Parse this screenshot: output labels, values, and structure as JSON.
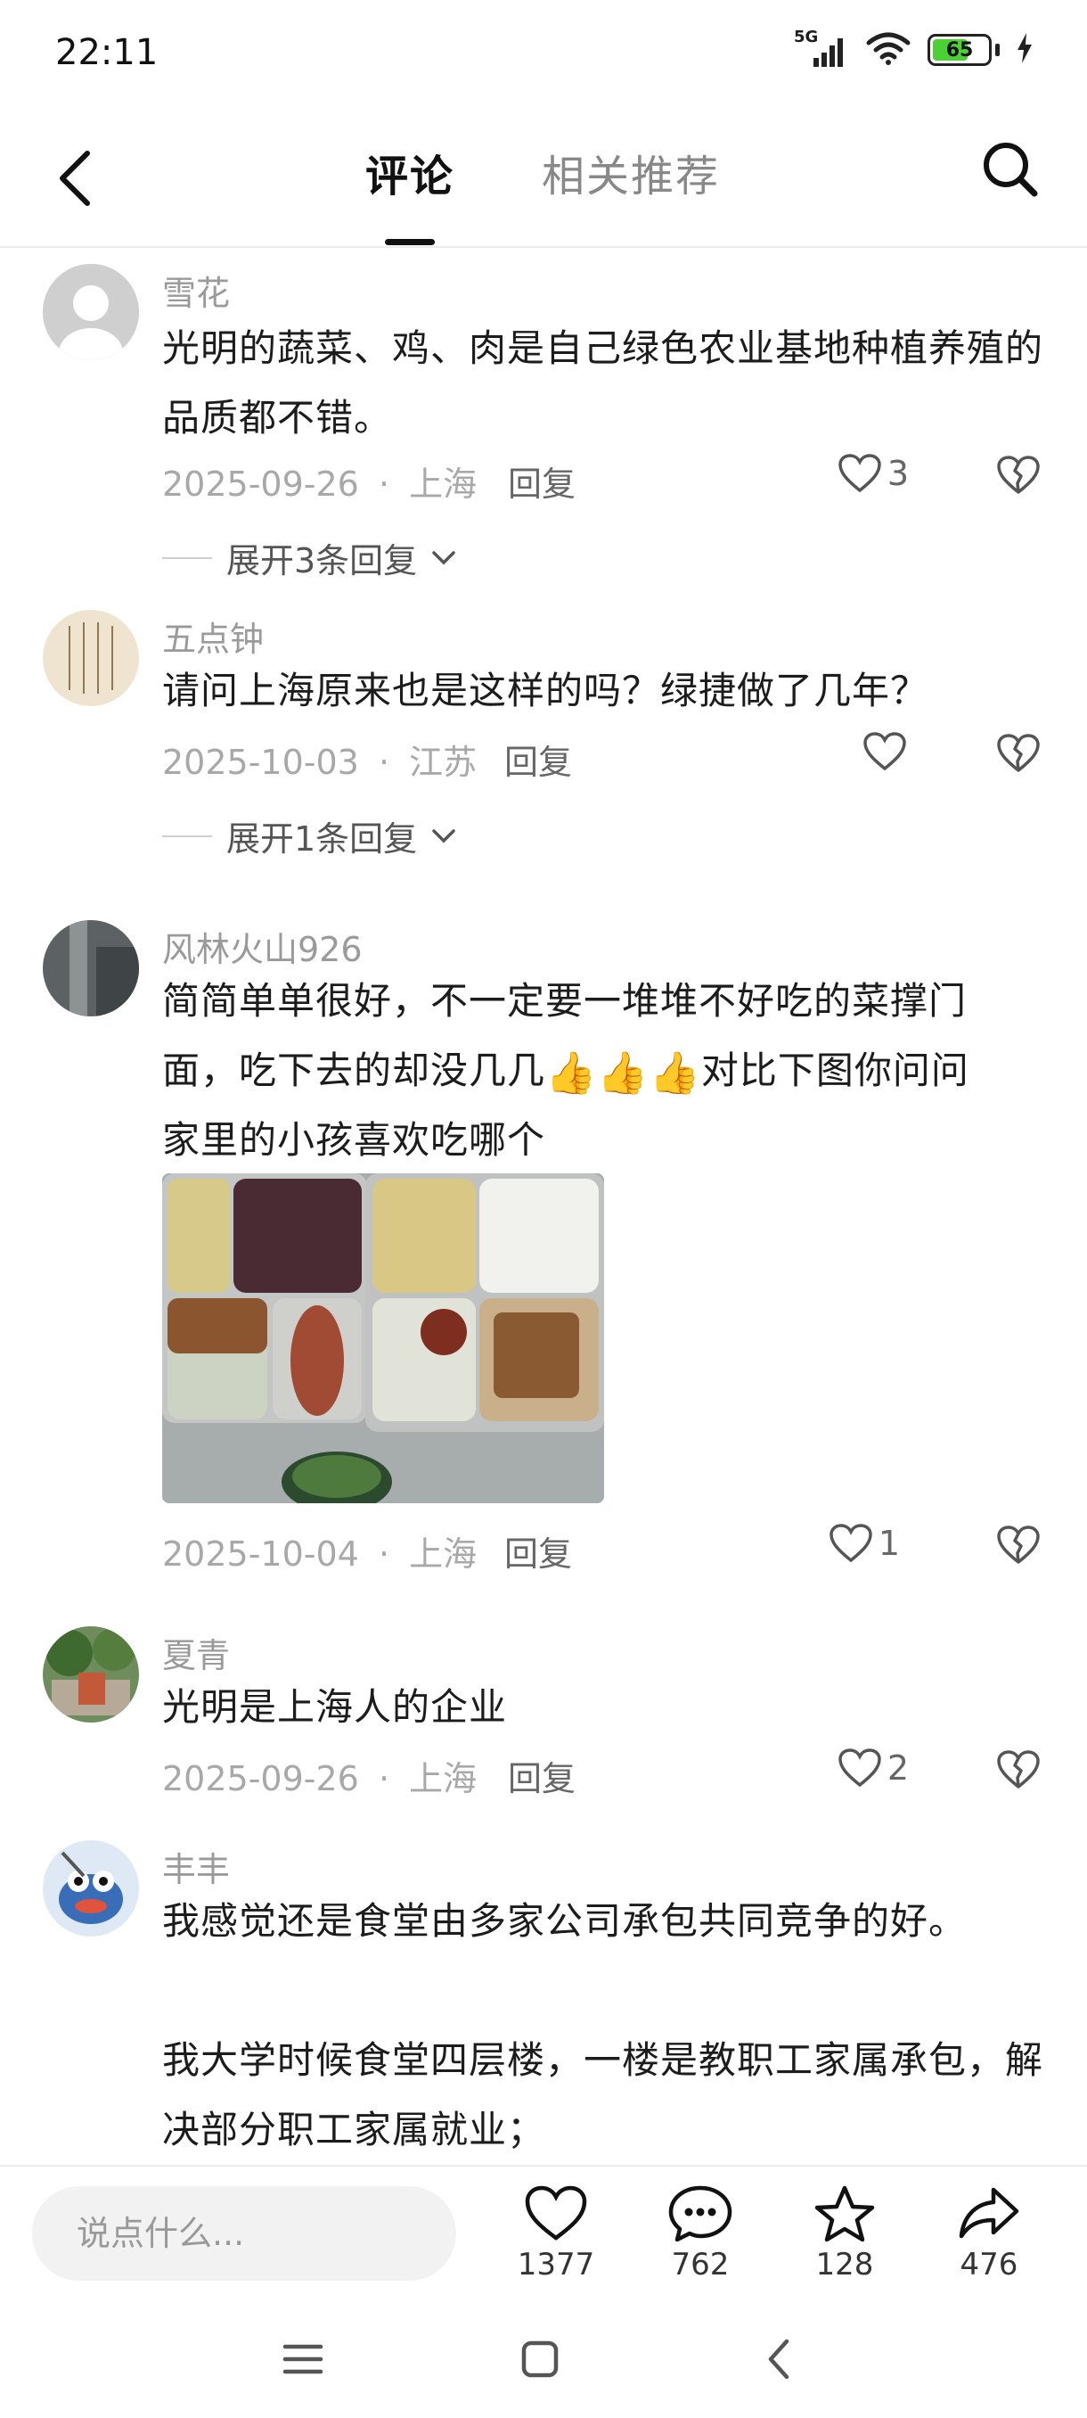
{
  "status_bar": {
    "time": "22:11",
    "battery": "65",
    "network": "5G"
  },
  "nav": {
    "tabs": [
      {
        "label": "评论"
      },
      {
        "label": "相关推荐"
      }
    ]
  },
  "comments": [
    {
      "name": "雪花",
      "text": "光明的蔬菜、鸡、肉是自己绿色农业基地种植养殖的品质都不错。",
      "date": "2025-09-26",
      "location": "上海",
      "reply_label": "回复",
      "likes": "3",
      "expand_label": "展开3条回复"
    },
    {
      "name": "五点钟",
      "text": "请问上海原来也是这样的吗？绿捷做了几年？",
      "date": "2025-10-03",
      "location": "江苏",
      "reply_label": "回复",
      "likes": "",
      "expand_label": "展开1条回复"
    },
    {
      "name": "风林火山926",
      "text_line1": "简简单单很好，不一定要一堆堆不好吃的菜撑门",
      "text_line2a": "面，吃下去的却没几几",
      "text_line2b": "对比下图你问问",
      "text_line3": "家里的小孩喜欢吃哪个",
      "date": "2025-10-04",
      "location": "上海",
      "reply_label": "回复",
      "likes": "1"
    },
    {
      "name": "夏青",
      "text": "光明是上海人的企业",
      "date": "2025-09-26",
      "location": "上海",
      "reply_label": "回复",
      "likes": "2"
    },
    {
      "name": "丰丰",
      "text_p1": "我感觉还是食堂由多家公司承包共同竞争的好。",
      "text_p2": "我大学时候食堂四层楼，一楼是教职工家属承包，解决部分职工家属就业；"
    }
  ],
  "separator": "·",
  "bottom_bar": {
    "input_placeholder": "说点什么...",
    "likes": "1377",
    "comments": "762",
    "favorites": "128",
    "shares": "476"
  },
  "colors": {
    "battery_green": "#4cd134",
    "text_muted": "#9a9a9a"
  }
}
